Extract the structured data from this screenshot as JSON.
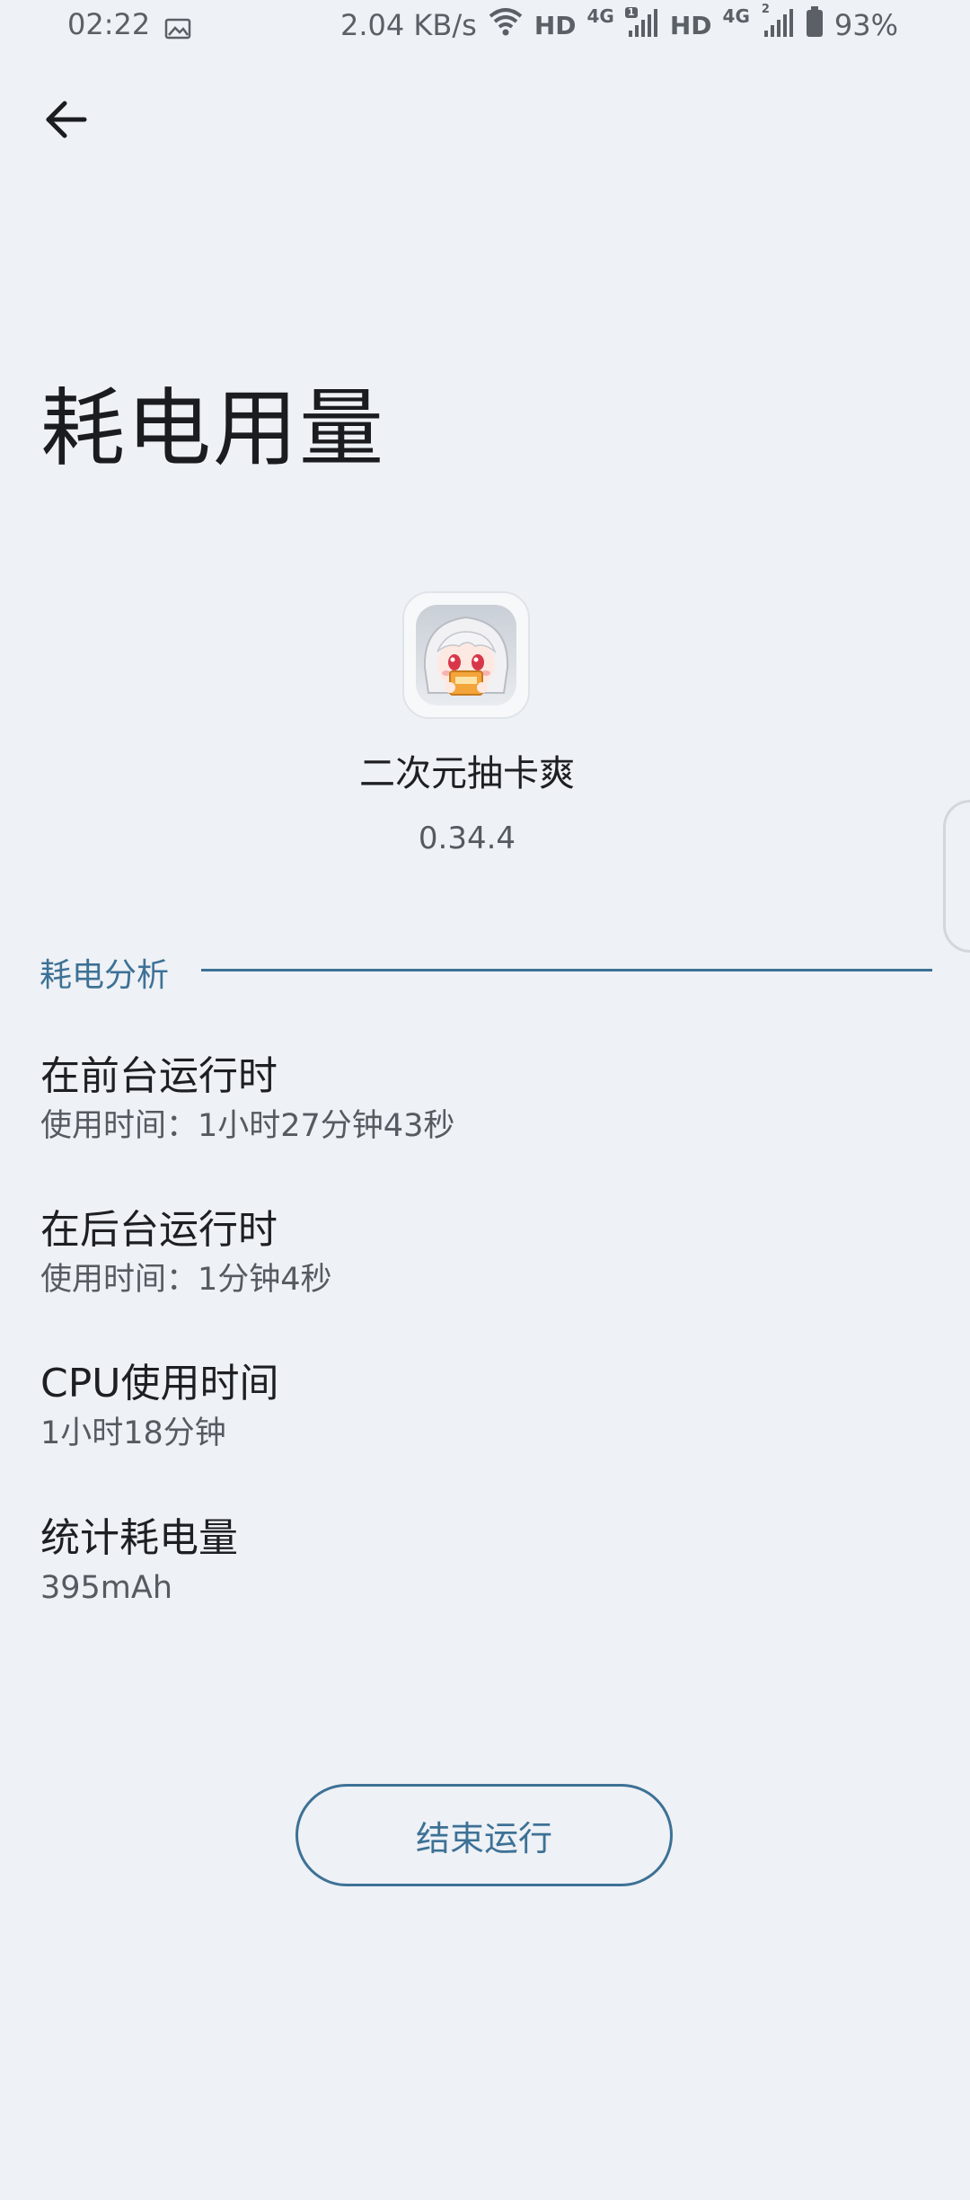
{
  "status_bar": {
    "time": "02:22",
    "network_speed": "2.04 KB/s",
    "sim1": {
      "hd": "HD",
      "net": "4G",
      "slot": "1"
    },
    "sim2": {
      "hd": "HD",
      "net": "4G",
      "slot": "2"
    },
    "battery": "93%",
    "battery_level": 0.93
  },
  "header": {
    "back_icon": "arrow-left-icon",
    "title": "耗电用量"
  },
  "app": {
    "name": "二次元抽卡爽",
    "version": "0.34.4"
  },
  "section": {
    "title": "耗电分析"
  },
  "stats": [
    {
      "title": "在前台运行时",
      "value": "使用时间：1小时27分钟43秒"
    },
    {
      "title": "在后台运行时",
      "value": "使用时间：1分钟4秒"
    },
    {
      "title": "CPU使用时间",
      "value": "1小时18分钟"
    },
    {
      "title": "统计耗电量",
      "value": "395mAh"
    }
  ],
  "actions": {
    "stop_label": "结束运行"
  },
  "colors": {
    "background": "#eef1f5",
    "accent": "#3d7196"
  }
}
